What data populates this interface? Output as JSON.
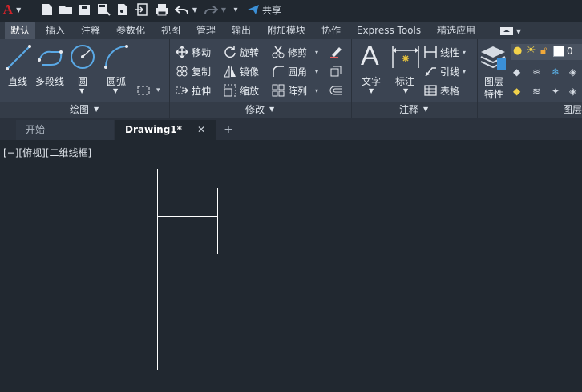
{
  "colors": {
    "accent": "#3b8fd6",
    "app_icon": "#d2232a",
    "canvas": "#212830",
    "ribbon": "#3b4452"
  },
  "app": {
    "logo_letter": "A"
  },
  "quick_access": {
    "share_label": "共享"
  },
  "tabs": [
    {
      "label": "默认"
    },
    {
      "label": "插入"
    },
    {
      "label": "注释"
    },
    {
      "label": "参数化"
    },
    {
      "label": "视图"
    },
    {
      "label": "管理"
    },
    {
      "label": "输出"
    },
    {
      "label": "附加模块"
    },
    {
      "label": "协作"
    },
    {
      "label": "Express Tools"
    },
    {
      "label": "精选应用"
    }
  ],
  "draw_panel": {
    "title": "绘图",
    "line": "直线",
    "polyline": "多段线",
    "circle": "圆",
    "arc": "圆弧"
  },
  "modify_panel": {
    "title": "修改",
    "move": "移动",
    "rotate": "旋转",
    "trim": "修剪",
    "copy": "复制",
    "mirror": "镜像",
    "fillet": "圆角",
    "stretch": "拉伸",
    "scale": "缩放",
    "array": "阵列"
  },
  "annotation_panel": {
    "title": "注释",
    "text": "文字",
    "dimension": "标注",
    "linear": "线性",
    "leader": "引线",
    "table": "表格"
  },
  "layers_panel": {
    "title": "图层",
    "properties_line1": "图层",
    "properties_line2": "特性",
    "current_layer": "0"
  },
  "doc_tabs": {
    "start": "开始",
    "drawing": "Drawing1*",
    "new_tab": "+"
  },
  "viewport": {
    "label": "[−][俯视][二维线框]"
  }
}
